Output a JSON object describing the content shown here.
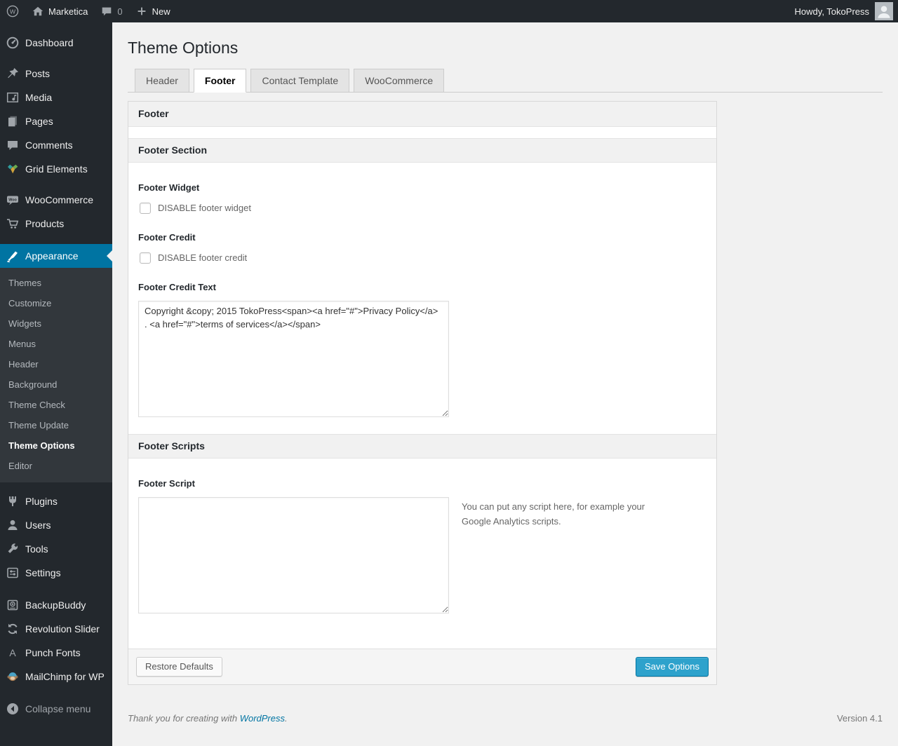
{
  "admin_bar": {
    "site_name": "Marketica",
    "comments_count": "0",
    "new_label": "New",
    "howdy": "Howdy, TokoPress"
  },
  "sidebar": {
    "items": [
      {
        "label": "Dashboard",
        "icon": "dashboard-icon"
      },
      {
        "label": "Posts",
        "icon": "posts-icon"
      },
      {
        "label": "Media",
        "icon": "media-icon"
      },
      {
        "label": "Pages",
        "icon": "pages-icon"
      },
      {
        "label": "Comments",
        "icon": "comments-icon"
      },
      {
        "label": "Grid Elements",
        "icon": "grid-elements-icon"
      },
      {
        "label": "WooCommerce",
        "icon": "woocommerce-icon"
      },
      {
        "label": "Products",
        "icon": "products-icon"
      },
      {
        "label": "Appearance",
        "icon": "appearance-icon",
        "active": true
      },
      {
        "label": "Plugins",
        "icon": "plugins-icon"
      },
      {
        "label": "Users",
        "icon": "users-icon"
      },
      {
        "label": "Tools",
        "icon": "tools-icon"
      },
      {
        "label": "Settings",
        "icon": "settings-icon"
      },
      {
        "label": "BackupBuddy",
        "icon": "backupbuddy-icon"
      },
      {
        "label": "Revolution Slider",
        "icon": "revolution-slider-icon"
      },
      {
        "label": "Punch Fonts",
        "icon": "punch-fonts-icon"
      },
      {
        "label": "MailChimp for WP",
        "icon": "mailchimp-icon"
      }
    ],
    "appearance_submenu": [
      "Themes",
      "Customize",
      "Widgets",
      "Menus",
      "Header",
      "Background",
      "Theme Check",
      "Theme Update",
      "Theme Options",
      "Editor"
    ],
    "current_submenu_item": "Theme Options",
    "collapse_label": "Collapse menu"
  },
  "page": {
    "title": "Theme Options",
    "tabs": [
      {
        "label": "Header",
        "active": false
      },
      {
        "label": "Footer",
        "active": true
      },
      {
        "label": "Contact Template",
        "active": false
      },
      {
        "label": "WooCommerce",
        "active": false
      }
    ]
  },
  "panel": {
    "title": "Footer",
    "section1": {
      "title": "Footer Section",
      "footer_widget_label": "Footer Widget",
      "footer_widget_checkbox": "DISABLE footer widget",
      "footer_widget_checked": false,
      "footer_credit_label": "Footer Credit",
      "footer_credit_checkbox": "DISABLE footer credit",
      "footer_credit_checked": false,
      "footer_credit_text_label": "Footer Credit Text",
      "footer_credit_text_value": "Copyright &copy; 2015 TokoPress<span><a href=\"#\">Privacy Policy</a> . <a href=\"#\">terms of services</a></span>"
    },
    "section2": {
      "title": "Footer Scripts",
      "footer_script_label": "Footer Script",
      "footer_script_value": "",
      "footer_script_help": "You can put any script here, for example your Google Analytics scripts."
    },
    "buttons": {
      "restore": "Restore Defaults",
      "save": "Save Options"
    }
  },
  "footer": {
    "thanks_prefix": "Thank you for creating with ",
    "thanks_link": "WordPress",
    "thanks_suffix": ".",
    "version": "Version 4.1"
  },
  "icons": {
    "wordpress-logo": "circle with W",
    "home-icon": "house",
    "comments-bubble-icon": "speech bubble",
    "plus-icon": "plus sign",
    "avatar": "person silhouette",
    "current-menu-arrow": "notch pointing into menu"
  },
  "colors": {
    "admin_bar_bg": "#23282d",
    "sidebar_bg": "#23282d",
    "submenu_bg": "#32373c",
    "menu_highlight": "#0074a2",
    "page_bg": "#f1f1f1",
    "primary_button": "#2ea2cc",
    "link": "#0074a2"
  }
}
